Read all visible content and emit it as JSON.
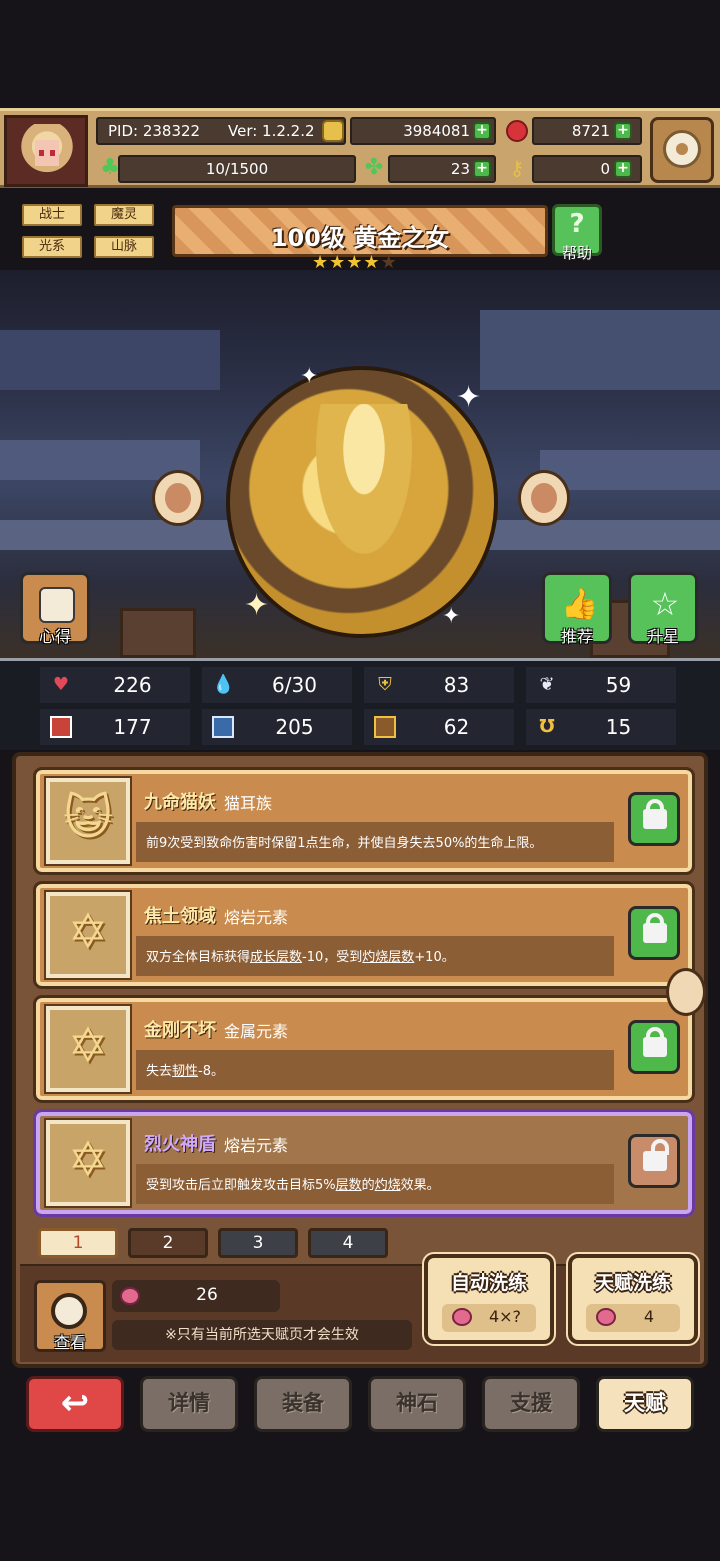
{
  "header": {
    "pid": "PID: 238322",
    "version": "Ver: 1.2.2.2",
    "gold": "3984081",
    "gems": "8721",
    "energy": "10/1500",
    "clovers": "23",
    "keys": "0"
  },
  "hero": {
    "tags": [
      "战士",
      "魔灵",
      "光系",
      "山脉"
    ],
    "title": "100级 黄金之女",
    "stars_filled": 4,
    "stars_total": 5,
    "help_label": "帮助",
    "left_button": "心得",
    "recommend_button": "推荐",
    "upgrade_button": "升星"
  },
  "stats": [
    {
      "icon": "heart-icon",
      "value": "226"
    },
    {
      "icon": "water-drop-icon",
      "value": "6/30"
    },
    {
      "icon": "shield-icon",
      "value": "83"
    },
    {
      "icon": "wing-icon",
      "value": "59"
    },
    {
      "icon": "fist-icon",
      "value": "177"
    },
    {
      "icon": "book-icon",
      "value": "205"
    },
    {
      "icon": "scroll-icon",
      "value": "62"
    },
    {
      "icon": "horseshoe-icon",
      "value": "15"
    }
  ],
  "talents": [
    {
      "name": "九命猫妖",
      "kind": "猫耳族",
      "desc_pre": "前9次受到致命伤害时保留1点生命，并使自身失去50%的生命上限。",
      "locked": true
    },
    {
      "name": "焦土领域",
      "kind": "熔岩元素",
      "desc_a": "双方全体目标获得",
      "link1": "成长层数",
      "desc_b": "-10，受到",
      "link2": "灼烧层数",
      "desc_c": "+10。",
      "locked": true
    },
    {
      "name": "金刚不坏",
      "kind": "金属元素",
      "desc_a": "失去",
      "link1": "韧性",
      "desc_b": "-8。",
      "locked": true
    },
    {
      "name": "烈火神盾",
      "kind": "熔岩元素",
      "desc_a": "受到攻击后立即触发攻击目标5%",
      "link1": "层数",
      "desc_b": "的",
      "link2": "灼烧",
      "desc_c": "效果。",
      "locked": false
    }
  ],
  "pages": [
    "1",
    "2",
    "3",
    "4"
  ],
  "bottom": {
    "view_label": "查看",
    "fruit_count": "26",
    "note": "※只有当前所选天赋页才会生效",
    "auto_wash_label": "自动洗练",
    "auto_wash_cost": "4×?",
    "talent_wash_label": "天赋洗练",
    "talent_wash_cost": "4"
  },
  "nav": {
    "back_icon": "return-arrow-icon",
    "back_glyph": "↩",
    "items": [
      "详情",
      "装备",
      "神石",
      "支援",
      "天赋"
    ]
  },
  "colors": {
    "accent_green": "#4fb84a",
    "panel_brown": "#7a5438",
    "selected_purple": "#c9a6f2",
    "back_red": "#e04848"
  }
}
